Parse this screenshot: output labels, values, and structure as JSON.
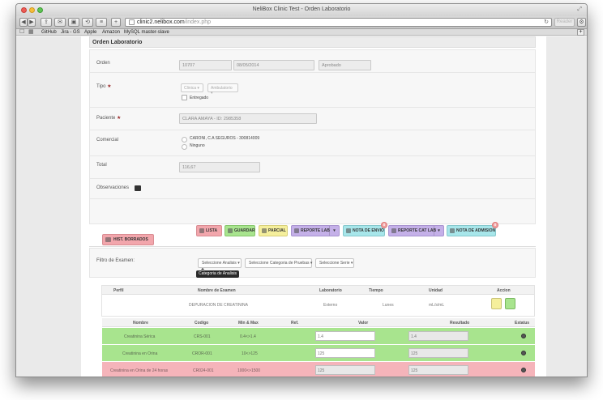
{
  "window": {
    "title": "NeliBox Clinic Test - Orden Laboratorio"
  },
  "toolbar": {
    "url_host": "clinic2.nelibox.com",
    "url_path": "/index.php",
    "reader_label": "Reader"
  },
  "bookmarks": [
    "GitHub",
    "Jira - GS",
    "Apple",
    "Amazon",
    "MySQL master-slave"
  ],
  "page": {
    "panel_title": "Orden Laboratorio",
    "form": {
      "orden_label": "Orden",
      "orden_number": "10707",
      "orden_date": "08/05/2014",
      "orden_status": "Aprobado",
      "tipo_label": "Tipo",
      "tipo_select_1": "Clinica",
      "tipo_select_2": "Ambulatorio",
      "entregado_label": "Entregado",
      "paciente_label": "Paciente",
      "paciente_value": "CLARA AMAYA - ID: 2985358",
      "comercial_label": "Comercial",
      "comercial_option_1": "CARONI, C.A SEGUROS - 300814009",
      "comercial_option_2": "Ninguno",
      "total_label": "Total",
      "total_value": "116,67",
      "observaciones_label": "Observaciones"
    },
    "actions": {
      "lista": "LISTA",
      "guardar": "GUARDAR",
      "parcial": "PARCIAL",
      "reporte_lab": "REPORTE LAB",
      "nota_envio": "NOTA DE ENVIO",
      "nota_envio_badge": "0",
      "reporte_cat_lab": "REPORTE CAT LAB",
      "nota_admision": "NOTA DE ADMISION",
      "nota_admision_badge": "0"
    },
    "hist_tab": "HIST. BORRADOS",
    "filter": {
      "label": "Filtro de Examen:",
      "select_analisis": "Seleccione Analisis",
      "select_categoria": "Seleccione Categoria de Pruebas",
      "select_serie": "Seleccione Serie",
      "tooltip": "Categoria de Analisis"
    },
    "exam_table": {
      "headers": [
        "Perfil",
        "Nombre de Examen",
        "Laboratorio",
        "Tiempo",
        "Unidad",
        "Accion"
      ],
      "row": {
        "perfil": "",
        "nombre": "DEPURACION DE CREATININA",
        "laboratorio": "Externo",
        "tiempo": "Lunes",
        "unidad": "mL/s/mL"
      }
    },
    "results_table": {
      "headers": [
        "Nombre",
        "Codigo",
        "Min & Max",
        "Ref.",
        "Valor",
        "Resultado",
        "Estatus"
      ],
      "rows": [
        {
          "nombre": "Creatinina Sérica",
          "codigo": "CRS-001",
          "minmax": "0.4<>1.4",
          "valor": "1.4",
          "resultado": "1.4"
        },
        {
          "nombre": "Creatinina en Orina",
          "codigo": "CROR-001",
          "minmax": "10<>125",
          "valor": "125",
          "resultado": "125"
        },
        {
          "nombre": "Creatinina en Orina de 24 horas",
          "codigo": "CR024-001",
          "minmax": "1000<>1500",
          "valor": "125",
          "resultado": "125"
        }
      ]
    }
  },
  "colors": {
    "row_ok": "#a8e48e",
    "row_bad": "#f5b4ba",
    "btn_red": "#f2a6ac",
    "btn_green": "#a8e48e",
    "btn_yellow": "#f5ef9c",
    "btn_purple": "#c4b0e8",
    "btn_cyan": "#a7e6ea"
  }
}
